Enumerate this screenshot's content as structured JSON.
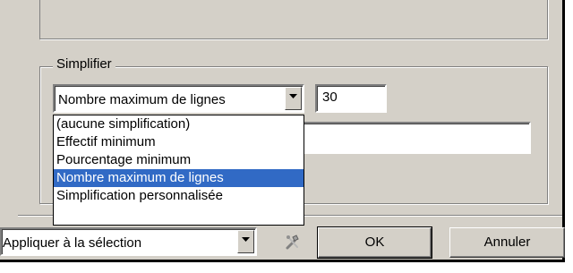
{
  "simplifier": {
    "group_label": "Simplifier",
    "mode_select_value": "Nombre maximum de lignes",
    "max_lines_value": "30",
    "options": [
      "(aucune simplification)",
      "Effectif minimum",
      "Pourcentage minimum",
      "Nombre maximum de lignes",
      "Simplification personnalisée"
    ],
    "selected_option": "Nombre maximum de lignes"
  },
  "footer": {
    "apply_select_value": "Appliquer à la sélection",
    "ok_label": "OK",
    "cancel_label": "Annuler"
  },
  "icons": {
    "dropdown": "chevron-down-icon",
    "tool": "tools-icon"
  },
  "colors": {
    "window_bg": "#d4d0c8",
    "selection_bg": "#316ac5"
  }
}
